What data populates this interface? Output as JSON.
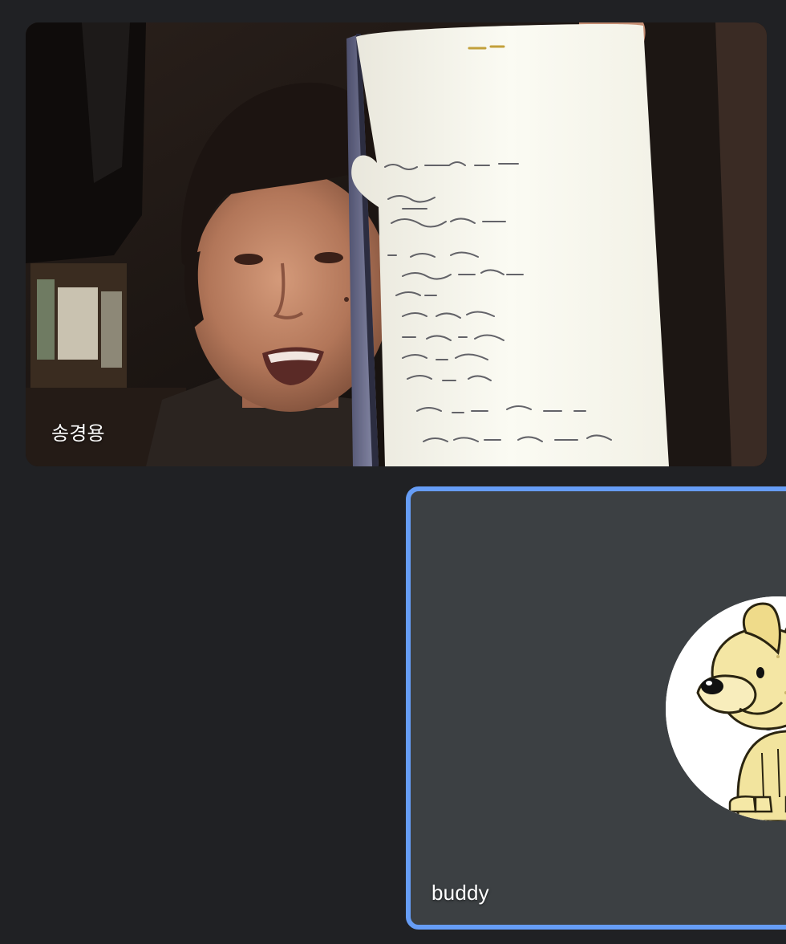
{
  "meeting": {
    "tiles": [
      {
        "participant_name": "송경용",
        "media": "camera-video"
      },
      {
        "participant_name": "buddy",
        "media": "avatar",
        "avatar_icon": "dog-cartoon-avatar",
        "active_speaker": true
      }
    ]
  },
  "colors": {
    "page_background": "#202124",
    "tile_background": "#3c4043",
    "active_speaker_border": "#669df6",
    "name_label": "#ffffff"
  }
}
